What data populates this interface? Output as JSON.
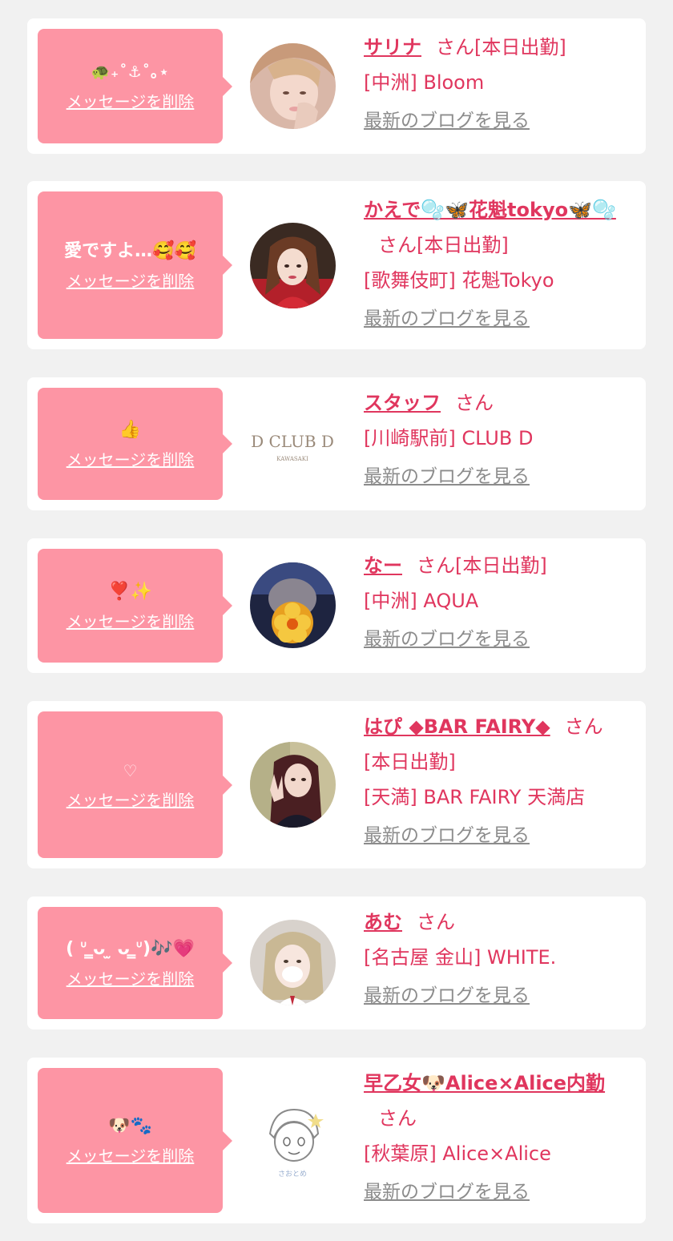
{
  "common": {
    "delete_label": "メッセージを削除",
    "blog_label": "最新のブログを見る",
    "honorific": "さん"
  },
  "colors": {
    "bubble": "#fd95a4",
    "accent": "#e0365e",
    "background": "#f1f1f1"
  },
  "messages": [
    {
      "message": "🐢₊˚⚓︎˚｡⋆",
      "name": "サリナ",
      "status": "[本日出勤]",
      "shop": "[中洲] Bloom",
      "avatar": "photo-avatar-blonde"
    },
    {
      "message": "愛ですよ…🥰🥰",
      "name": "かえで🫧🦋花魁tokyo🦋🫧",
      "status": "[本日出勤]",
      "shop": "[歌舞伎町] 花魁Tokyo",
      "avatar": "photo-avatar-brunette"
    },
    {
      "message": "👍",
      "name": "スタッフ",
      "status": "",
      "shop": "[川崎駅前] CLUB D",
      "avatar": "club-d-logo"
    },
    {
      "message": "❣️✨",
      "name": "なー",
      "status": "[本日出勤]",
      "shop": "[中洲] AQUA",
      "avatar": "photo-avatar-flower-mask"
    },
    {
      "message": "♡",
      "name": "はぴ ◆BAR FAIRY◆",
      "status": "[本日出勤]",
      "shop": "[天満] BAR FAIRY 天満店",
      "avatar": "photo-avatar-peace-sign"
    },
    {
      "message": "( ᐡ ̳ᴗ ̫ ᴗ ̳ᐡ)🎶💗",
      "name": "あむ",
      "status": "",
      "shop": "[名古屋 金山] WHITE.",
      "avatar": "photo-avatar-ash-blonde"
    },
    {
      "message": "🐶🐾",
      "name": "早乙女🐶Alice×Alice内勤",
      "status": "",
      "shop": "[秋葉原] Alice×Alice",
      "avatar": "illustration-avatar"
    }
  ]
}
